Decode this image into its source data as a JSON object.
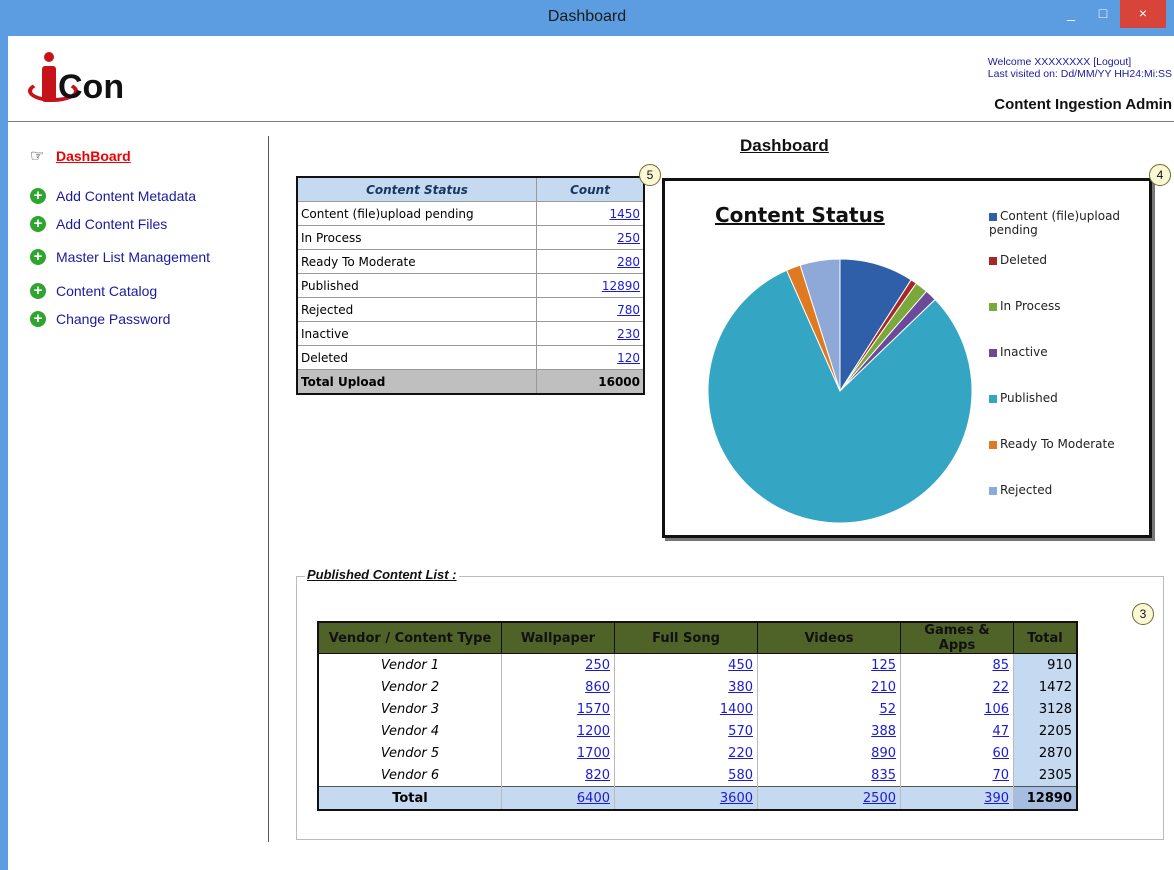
{
  "window": {
    "title": "Dashboard",
    "minimize": "_",
    "maximize": "□",
    "close": "×"
  },
  "header": {
    "logo_text": "Con",
    "welcome": "Welcome XXXXXXXX [Logout]",
    "last_visited": "Last visited on: Dd/MM/YY HH24:Mi:SS",
    "admin_title": "Content Ingestion Admin"
  },
  "sidebar": {
    "items": [
      {
        "label": "DashBoard",
        "icon": "pointing-hand-icon",
        "active": true
      },
      {
        "label": "Add Content Metadata",
        "icon": "plus-circle-icon"
      },
      {
        "label": "Add Content Files",
        "icon": "plus-circle-icon"
      },
      {
        "label": "Master List Management",
        "icon": "plus-circle-icon"
      },
      {
        "label": "Content Catalog",
        "icon": "plus-circle-icon"
      },
      {
        "label": "Change Password",
        "icon": "plus-circle-icon"
      }
    ]
  },
  "main": {
    "title": "Dashboard",
    "status_table": {
      "headers": [
        "Content Status",
        "Count"
      ],
      "rows": [
        {
          "label": "Content (file)upload pending",
          "count": "1450"
        },
        {
          "label": "In Process",
          "count": "250"
        },
        {
          "label": "Ready To Moderate",
          "count": "280"
        },
        {
          "label": "Published",
          "count": "12890"
        },
        {
          "label": "Rejected",
          "count": "780"
        },
        {
          "label": "Inactive",
          "count": "230"
        },
        {
          "label": "Deleted",
          "count": "120"
        }
      ],
      "total_label": "Total Upload",
      "total_value": "16000",
      "badge": "5"
    },
    "chart_badge": "4",
    "published": {
      "title": "Published Content List :",
      "badge": "3",
      "headers": [
        "Vendor / Content Type",
        "Wallpaper",
        "Full Song",
        "Videos",
        "Games & Apps",
        "Total"
      ],
      "rows": [
        {
          "vendor": "Vendor 1",
          "values": [
            "250",
            "450",
            "125",
            "85"
          ],
          "total": "910"
        },
        {
          "vendor": "Vendor 2",
          "values": [
            "860",
            "380",
            "210",
            "22"
          ],
          "total": "1472"
        },
        {
          "vendor": "Vendor 3",
          "values": [
            "1570",
            "1400",
            "52",
            "106"
          ],
          "total": "3128"
        },
        {
          "vendor": "Vendor 4",
          "values": [
            "1200",
            "570",
            "388",
            "47"
          ],
          "total": "2205"
        },
        {
          "vendor": "Vendor 5",
          "values": [
            "1700",
            "220",
            "890",
            "60"
          ],
          "total": "2870"
        },
        {
          "vendor": "Vendor 6",
          "values": [
            "820",
            "580",
            "835",
            "70"
          ],
          "total": "2305"
        }
      ],
      "total_row": {
        "label": "Total",
        "values": [
          "6400",
          "3600",
          "2500",
          "390"
        ],
        "total": "12890"
      }
    }
  },
  "chart_data": {
    "type": "pie",
    "title": "Content Status",
    "legend_position": "right",
    "categories": [
      "Content (file)upload pending",
      "Deleted",
      "In Process",
      "Inactive",
      "Published",
      "Ready To Moderate",
      "Rejected"
    ],
    "values": [
      1450,
      120,
      250,
      230,
      12890,
      280,
      780
    ],
    "colors": [
      "#2e5fa8",
      "#a8282a",
      "#7aa83a",
      "#6b4a9a",
      "#34a6c4",
      "#e07a22",
      "#8ea8d8"
    ]
  }
}
